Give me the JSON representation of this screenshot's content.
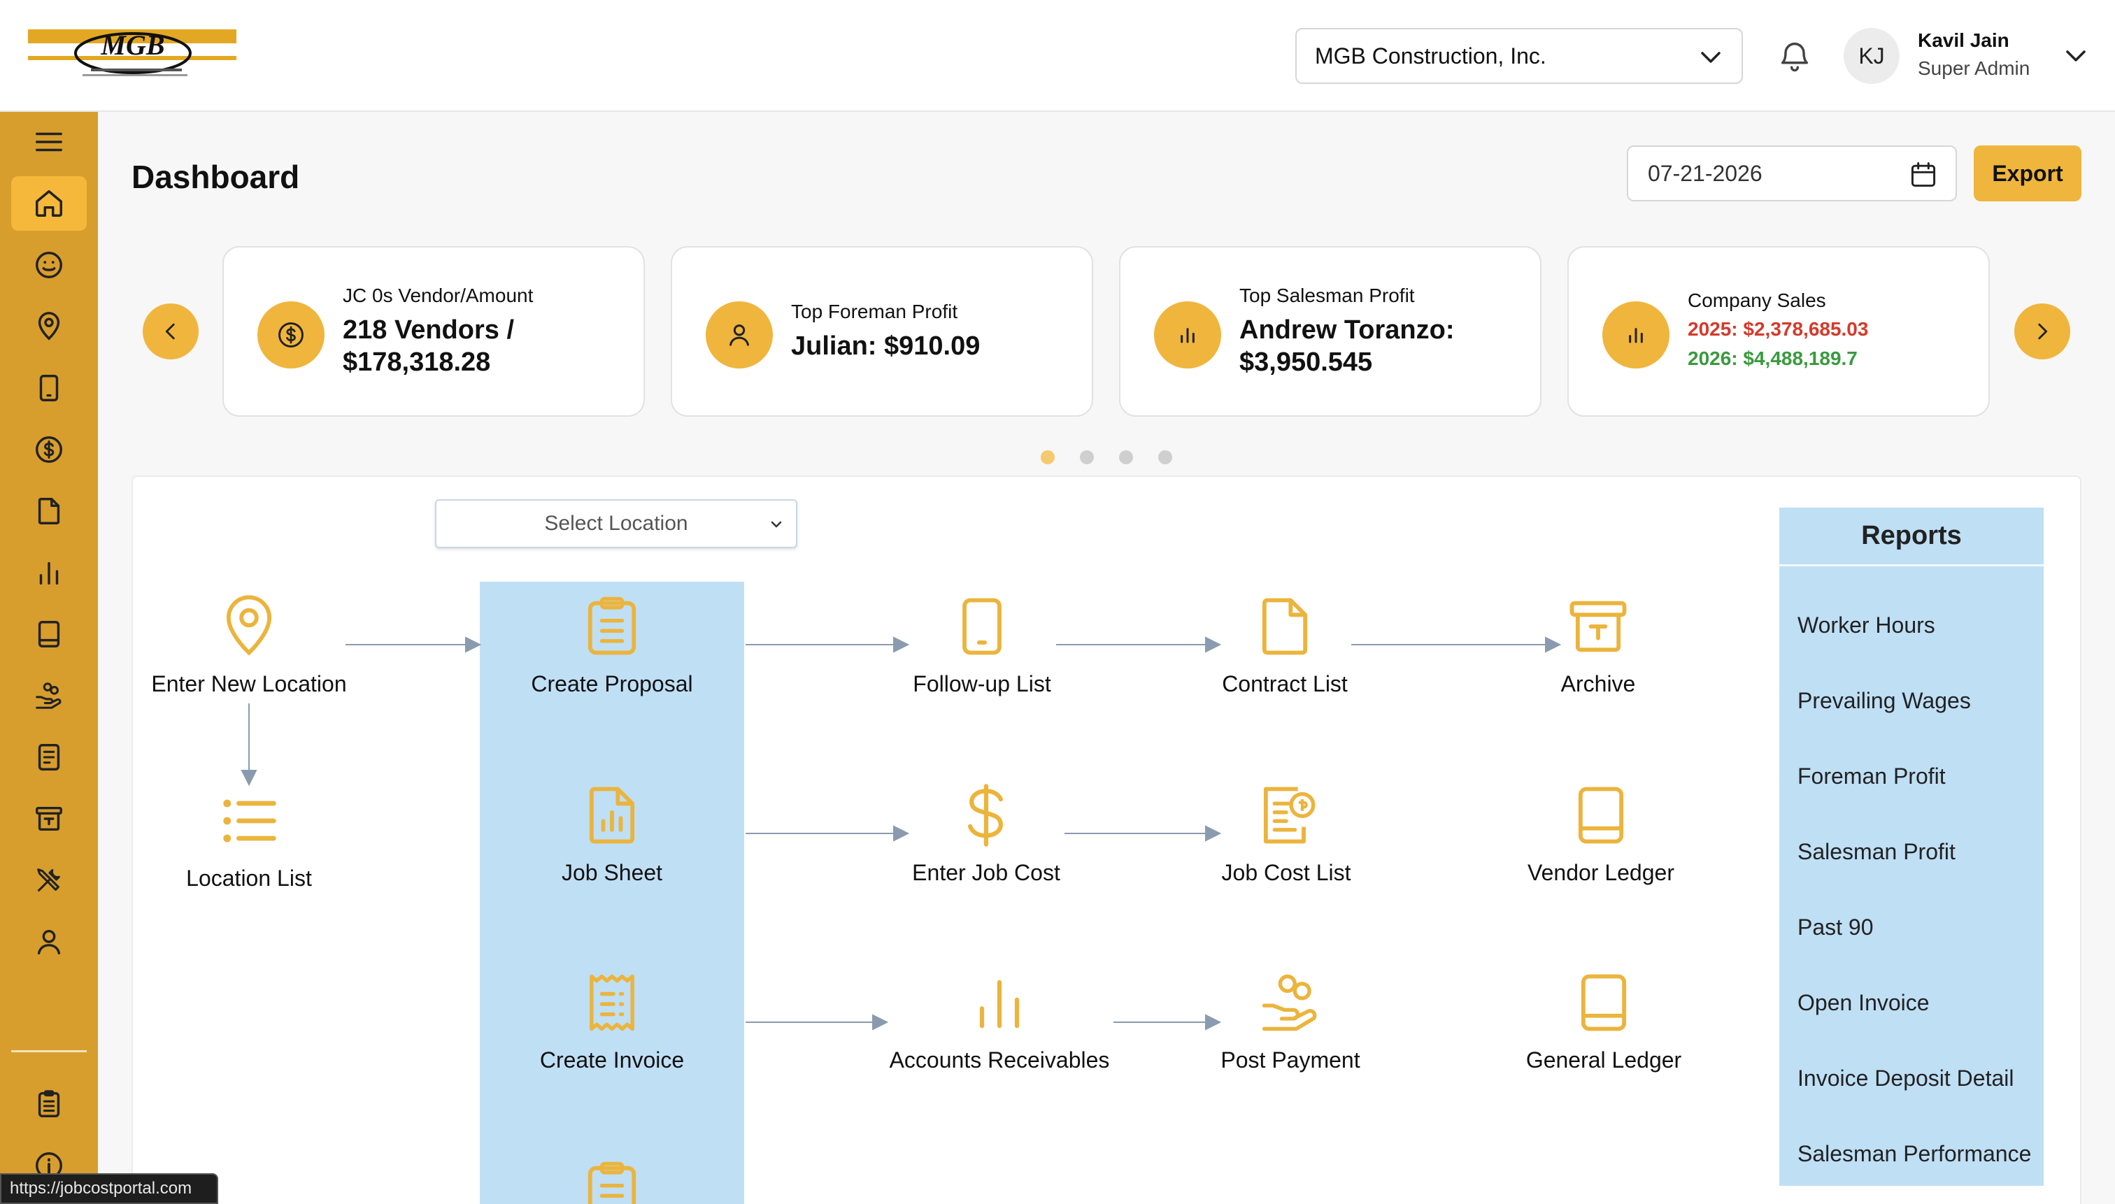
{
  "header": {
    "logo_text": "MGB",
    "company": "MGB Construction, Inc.",
    "user_initials": "KJ",
    "user_name": "Kavil Jain",
    "user_role": "Super Admin"
  },
  "sidebar": {
    "items": [
      {
        "icon": "menu-icon"
      },
      {
        "icon": "home-icon",
        "active": true
      },
      {
        "icon": "smiley-icon"
      },
      {
        "icon": "location-pin-icon"
      },
      {
        "icon": "tablet-icon"
      },
      {
        "icon": "dollar-circle-icon"
      },
      {
        "icon": "file-icon"
      },
      {
        "icon": "bar-chart-icon"
      },
      {
        "icon": "book-icon"
      },
      {
        "icon": "hand-coins-icon"
      },
      {
        "icon": "document-lines-icon"
      },
      {
        "icon": "archive-icon"
      },
      {
        "icon": "tools-icon"
      },
      {
        "icon": "user-icon"
      },
      {
        "icon": "clipboard-icon"
      },
      {
        "icon": "info-icon"
      }
    ]
  },
  "main": {
    "title": "Dashboard",
    "date": "07-21-2026",
    "export_label": "Export"
  },
  "cards": [
    {
      "label": "JC 0s Vendor/Amount",
      "value": "218 Vendors / $178,318.28",
      "icon": "dollar-circle-icon"
    },
    {
      "label": "Top Foreman Profit",
      "value": "Julian: $910.09",
      "icon": "user-icon"
    },
    {
      "label": "Top Salesman Profit",
      "value": "Andrew Toranzo: $3,950.545",
      "icon": "bar-chart-icon"
    },
    {
      "label": "Company Sales",
      "value_2025": "2025: $2,378,685.03",
      "value_2026": "2026: $4,488,189.7",
      "icon": "bar-chart-icon"
    }
  ],
  "carousel": {
    "dots": 4,
    "active": 0
  },
  "workflow": {
    "select_location_placeholder": "Select Location",
    "nodes": {
      "enter_new_location": "Enter New Location",
      "location_list": "Location List",
      "create_proposal": "Create Proposal",
      "follow_up_list": "Follow-up List",
      "contract_list": "Contract List",
      "archive": "Archive",
      "job_sheet": "Job Sheet",
      "enter_job_cost": "Enter Job Cost",
      "job_cost_list": "Job Cost List",
      "vendor_ledger": "Vendor Ledger",
      "create_invoice": "Create Invoice",
      "accounts_receivables": "Accounts Receivables",
      "post_payment": "Post Payment",
      "general_ledger": "General Ledger"
    }
  },
  "reports": {
    "title": "Reports",
    "items": [
      "Worker Hours",
      "Prevailing Wages",
      "Foreman Profit",
      "Salesman Profit",
      "Past 90",
      "Open Invoice",
      "Invoice Deposit Detail",
      "Salesman Performance"
    ]
  },
  "status_bar": {
    "url": "https://jobcostportal.com"
  },
  "colors": {
    "accent": "#f0b53c",
    "sidebar": "#d79e2d",
    "highlight": "#bfdff5",
    "negative": "#d33a2c",
    "positive": "#3a9a3e"
  }
}
